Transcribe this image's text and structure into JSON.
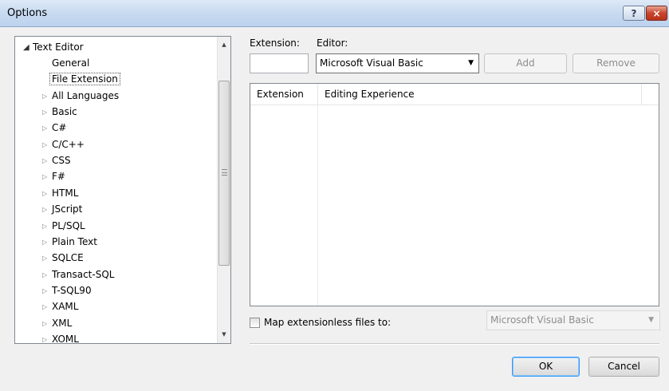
{
  "window": {
    "title": "Options",
    "help_label": "?",
    "close_label": "×"
  },
  "tree": {
    "root": {
      "label": "Text Editor",
      "expanded": true
    },
    "children": [
      {
        "label": "General",
        "expandable": false
      },
      {
        "label": "File Extension",
        "expandable": false,
        "selected": true
      },
      {
        "label": "All Languages",
        "expandable": true
      },
      {
        "label": "Basic",
        "expandable": true
      },
      {
        "label": "C#",
        "expandable": true
      },
      {
        "label": "C/C++",
        "expandable": true
      },
      {
        "label": "CSS",
        "expandable": true
      },
      {
        "label": "F#",
        "expandable": true
      },
      {
        "label": "HTML",
        "expandable": true
      },
      {
        "label": "JScript",
        "expandable": true
      },
      {
        "label": "PL/SQL",
        "expandable": true
      },
      {
        "label": "Plain Text",
        "expandable": true
      },
      {
        "label": "SQLCE",
        "expandable": true
      },
      {
        "label": "Transact-SQL",
        "expandable": true
      },
      {
        "label": "T-SQL90",
        "expandable": true
      },
      {
        "label": "XAML",
        "expandable": true
      },
      {
        "label": "XML",
        "expandable": true
      },
      {
        "label": "XOML",
        "expandable": true
      }
    ]
  },
  "extension": {
    "label": "Extension:",
    "value": ""
  },
  "editor": {
    "label": "Editor:",
    "selected": "Microsoft Visual Basic"
  },
  "buttons": {
    "add": "Add",
    "remove": "Remove",
    "ok": "OK",
    "cancel": "Cancel"
  },
  "grid": {
    "columns": [
      "Extension",
      "Editing Experience"
    ],
    "rows": []
  },
  "map_extensionless": {
    "label": "Map extensionless files to:",
    "checked": false,
    "selected": "Microsoft Visual Basic"
  }
}
